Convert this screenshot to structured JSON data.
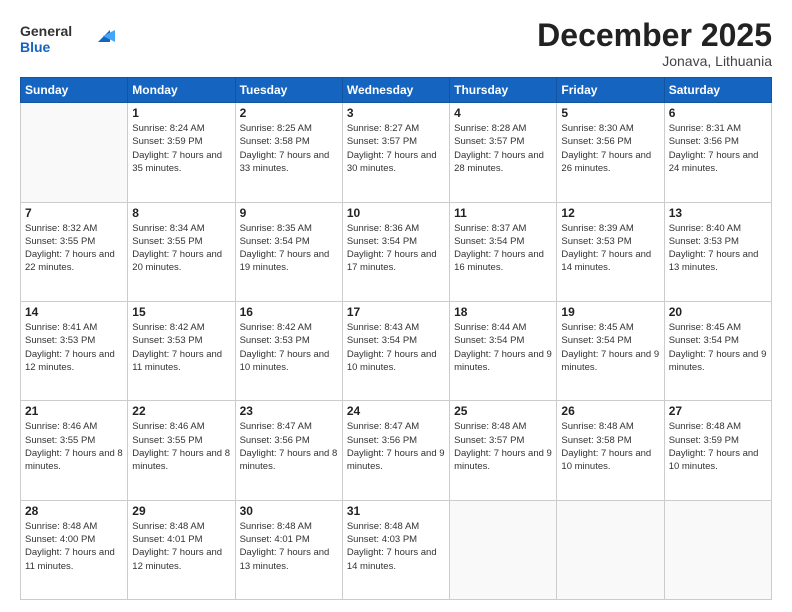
{
  "logo": {
    "general": "General",
    "blue": "Blue"
  },
  "header": {
    "month": "December 2025",
    "location": "Jonava, Lithuania"
  },
  "weekdays": [
    "Sunday",
    "Monday",
    "Tuesday",
    "Wednesday",
    "Thursday",
    "Friday",
    "Saturday"
  ],
  "weeks": [
    [
      {
        "day": "",
        "sunrise": "",
        "sunset": "",
        "daylight": ""
      },
      {
        "day": "1",
        "sunrise": "Sunrise: 8:24 AM",
        "sunset": "Sunset: 3:59 PM",
        "daylight": "Daylight: 7 hours and 35 minutes."
      },
      {
        "day": "2",
        "sunrise": "Sunrise: 8:25 AM",
        "sunset": "Sunset: 3:58 PM",
        "daylight": "Daylight: 7 hours and 33 minutes."
      },
      {
        "day": "3",
        "sunrise": "Sunrise: 8:27 AM",
        "sunset": "Sunset: 3:57 PM",
        "daylight": "Daylight: 7 hours and 30 minutes."
      },
      {
        "day": "4",
        "sunrise": "Sunrise: 8:28 AM",
        "sunset": "Sunset: 3:57 PM",
        "daylight": "Daylight: 7 hours and 28 minutes."
      },
      {
        "day": "5",
        "sunrise": "Sunrise: 8:30 AM",
        "sunset": "Sunset: 3:56 PM",
        "daylight": "Daylight: 7 hours and 26 minutes."
      },
      {
        "day": "6",
        "sunrise": "Sunrise: 8:31 AM",
        "sunset": "Sunset: 3:56 PM",
        "daylight": "Daylight: 7 hours and 24 minutes."
      }
    ],
    [
      {
        "day": "7",
        "sunrise": "Sunrise: 8:32 AM",
        "sunset": "Sunset: 3:55 PM",
        "daylight": "Daylight: 7 hours and 22 minutes."
      },
      {
        "day": "8",
        "sunrise": "Sunrise: 8:34 AM",
        "sunset": "Sunset: 3:55 PM",
        "daylight": "Daylight: 7 hours and 20 minutes."
      },
      {
        "day": "9",
        "sunrise": "Sunrise: 8:35 AM",
        "sunset": "Sunset: 3:54 PM",
        "daylight": "Daylight: 7 hours and 19 minutes."
      },
      {
        "day": "10",
        "sunrise": "Sunrise: 8:36 AM",
        "sunset": "Sunset: 3:54 PM",
        "daylight": "Daylight: 7 hours and 17 minutes."
      },
      {
        "day": "11",
        "sunrise": "Sunrise: 8:37 AM",
        "sunset": "Sunset: 3:54 PM",
        "daylight": "Daylight: 7 hours and 16 minutes."
      },
      {
        "day": "12",
        "sunrise": "Sunrise: 8:39 AM",
        "sunset": "Sunset: 3:53 PM",
        "daylight": "Daylight: 7 hours and 14 minutes."
      },
      {
        "day": "13",
        "sunrise": "Sunrise: 8:40 AM",
        "sunset": "Sunset: 3:53 PM",
        "daylight": "Daylight: 7 hours and 13 minutes."
      }
    ],
    [
      {
        "day": "14",
        "sunrise": "Sunrise: 8:41 AM",
        "sunset": "Sunset: 3:53 PM",
        "daylight": "Daylight: 7 hours and 12 minutes."
      },
      {
        "day": "15",
        "sunrise": "Sunrise: 8:42 AM",
        "sunset": "Sunset: 3:53 PM",
        "daylight": "Daylight: 7 hours and 11 minutes."
      },
      {
        "day": "16",
        "sunrise": "Sunrise: 8:42 AM",
        "sunset": "Sunset: 3:53 PM",
        "daylight": "Daylight: 7 hours and 10 minutes."
      },
      {
        "day": "17",
        "sunrise": "Sunrise: 8:43 AM",
        "sunset": "Sunset: 3:54 PM",
        "daylight": "Daylight: 7 hours and 10 minutes."
      },
      {
        "day": "18",
        "sunrise": "Sunrise: 8:44 AM",
        "sunset": "Sunset: 3:54 PM",
        "daylight": "Daylight: 7 hours and 9 minutes."
      },
      {
        "day": "19",
        "sunrise": "Sunrise: 8:45 AM",
        "sunset": "Sunset: 3:54 PM",
        "daylight": "Daylight: 7 hours and 9 minutes."
      },
      {
        "day": "20",
        "sunrise": "Sunrise: 8:45 AM",
        "sunset": "Sunset: 3:54 PM",
        "daylight": "Daylight: 7 hours and 9 minutes."
      }
    ],
    [
      {
        "day": "21",
        "sunrise": "Sunrise: 8:46 AM",
        "sunset": "Sunset: 3:55 PM",
        "daylight": "Daylight: 7 hours and 8 minutes."
      },
      {
        "day": "22",
        "sunrise": "Sunrise: 8:46 AM",
        "sunset": "Sunset: 3:55 PM",
        "daylight": "Daylight: 7 hours and 8 minutes."
      },
      {
        "day": "23",
        "sunrise": "Sunrise: 8:47 AM",
        "sunset": "Sunset: 3:56 PM",
        "daylight": "Daylight: 7 hours and 8 minutes."
      },
      {
        "day": "24",
        "sunrise": "Sunrise: 8:47 AM",
        "sunset": "Sunset: 3:56 PM",
        "daylight": "Daylight: 7 hours and 9 minutes."
      },
      {
        "day": "25",
        "sunrise": "Sunrise: 8:48 AM",
        "sunset": "Sunset: 3:57 PM",
        "daylight": "Daylight: 7 hours and 9 minutes."
      },
      {
        "day": "26",
        "sunrise": "Sunrise: 8:48 AM",
        "sunset": "Sunset: 3:58 PM",
        "daylight": "Daylight: 7 hours and 10 minutes."
      },
      {
        "day": "27",
        "sunrise": "Sunrise: 8:48 AM",
        "sunset": "Sunset: 3:59 PM",
        "daylight": "Daylight: 7 hours and 10 minutes."
      }
    ],
    [
      {
        "day": "28",
        "sunrise": "Sunrise: 8:48 AM",
        "sunset": "Sunset: 4:00 PM",
        "daylight": "Daylight: 7 hours and 11 minutes."
      },
      {
        "day": "29",
        "sunrise": "Sunrise: 8:48 AM",
        "sunset": "Sunset: 4:01 PM",
        "daylight": "Daylight: 7 hours and 12 minutes."
      },
      {
        "day": "30",
        "sunrise": "Sunrise: 8:48 AM",
        "sunset": "Sunset: 4:01 PM",
        "daylight": "Daylight: 7 hours and 13 minutes."
      },
      {
        "day": "31",
        "sunrise": "Sunrise: 8:48 AM",
        "sunset": "Sunset: 4:03 PM",
        "daylight": "Daylight: 7 hours and 14 minutes."
      },
      {
        "day": "",
        "sunrise": "",
        "sunset": "",
        "daylight": ""
      },
      {
        "day": "",
        "sunrise": "",
        "sunset": "",
        "daylight": ""
      },
      {
        "day": "",
        "sunrise": "",
        "sunset": "",
        "daylight": ""
      }
    ]
  ]
}
